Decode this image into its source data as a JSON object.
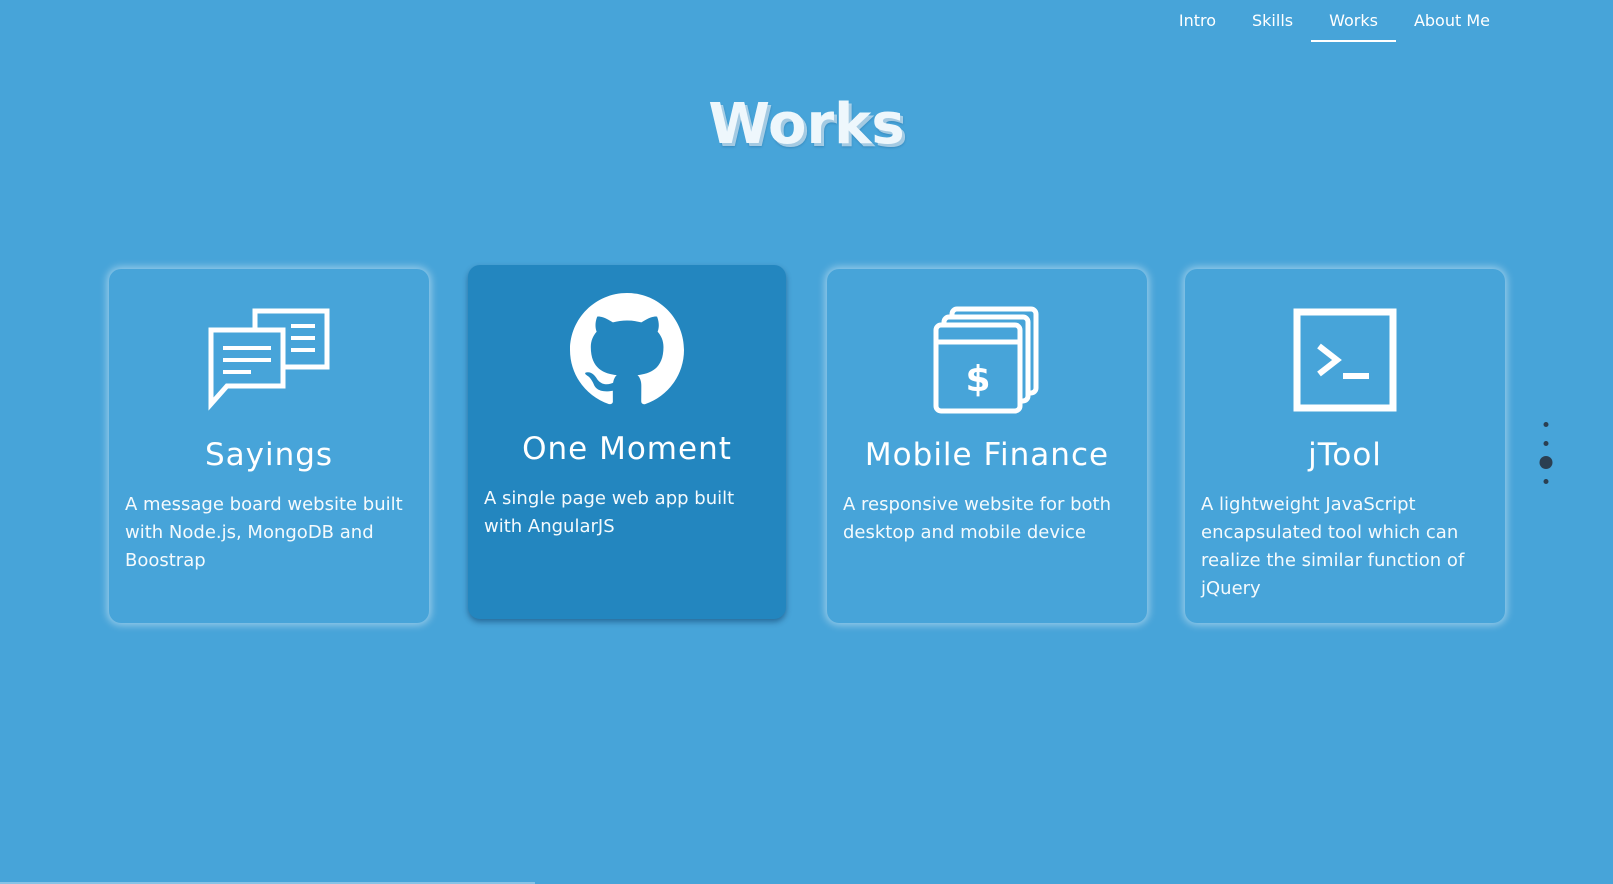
{
  "nav": {
    "items": [
      {
        "label": "Intro",
        "active": false
      },
      {
        "label": "Skills",
        "active": false
      },
      {
        "label": "Works",
        "active": true
      },
      {
        "label": "About Me",
        "active": false
      }
    ]
  },
  "page": {
    "title": "Works"
  },
  "cards": [
    {
      "icon": "chat-bubbles-icon",
      "title": "Sayings",
      "description": "A message board website built with Node.js, MongoDB and Boostrap"
    },
    {
      "icon": "github-icon",
      "title": "One Moment",
      "description": "A single page web app built with AngularJS",
      "highlighted": true
    },
    {
      "icon": "finance-cards-icon",
      "title": "Mobile Finance",
      "description": "A responsive website for both desktop and mobile device"
    },
    {
      "icon": "terminal-icon",
      "title": "jTool",
      "description": "A lightweight JavaScript encapsulated tool which can realize the similar function of jQuery"
    }
  ],
  "side_dots": {
    "count": 4,
    "active_index": 2
  },
  "colors": {
    "background": "#47a4d9",
    "card_highlight": "#2386bf",
    "text": "#ffffff",
    "dot": "#2b3f52"
  }
}
